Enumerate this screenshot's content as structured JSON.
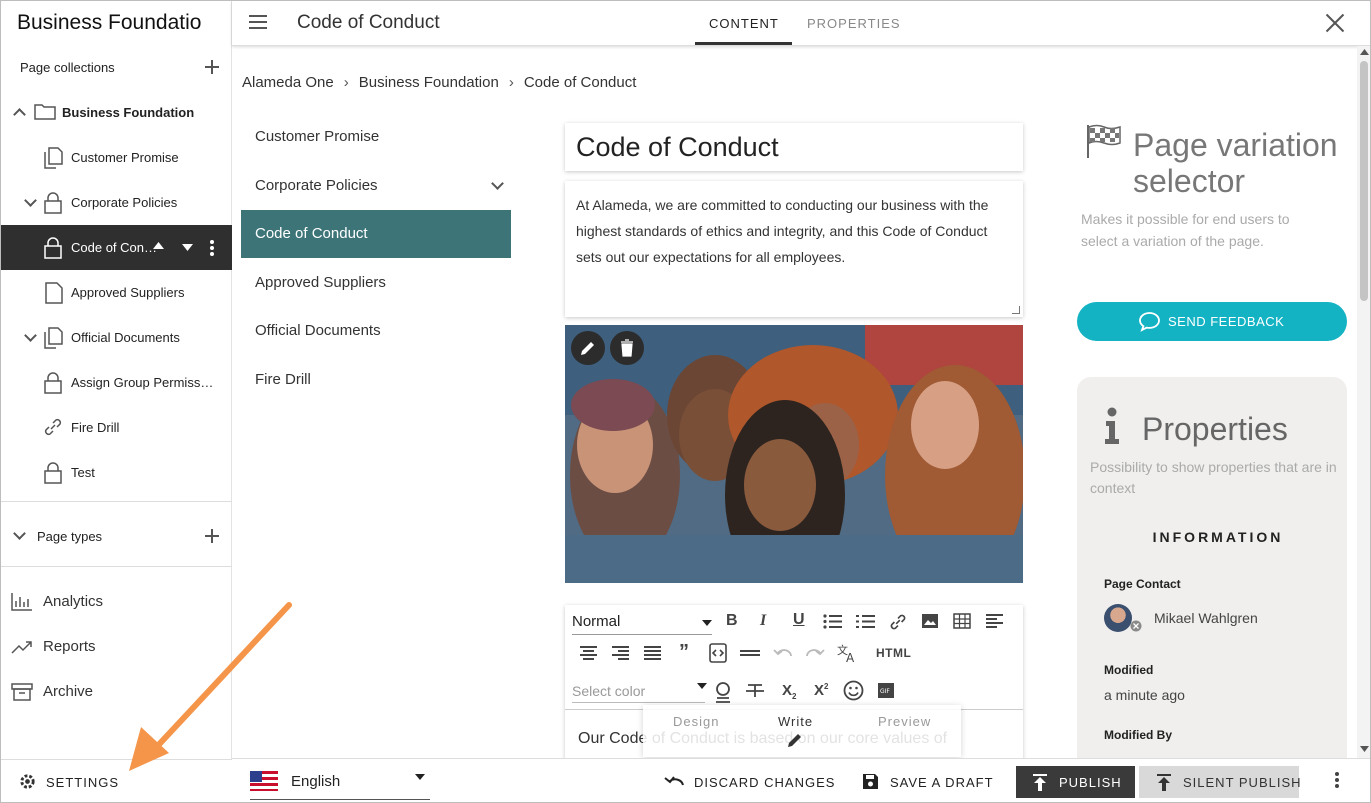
{
  "sidebar": {
    "title": "Business Foundatio",
    "collections_label": "Page collections",
    "tree": [
      {
        "label": "Business Foundation"
      },
      {
        "label": "Customer Promise"
      },
      {
        "label": "Corporate Policies"
      },
      {
        "label": "Code of Con…"
      },
      {
        "label": "Approved Suppliers"
      },
      {
        "label": "Official Documents"
      },
      {
        "label": "Assign Group Permiss…"
      },
      {
        "label": "Fire Drill"
      },
      {
        "label": "Test"
      }
    ],
    "page_types_label": "Page types",
    "nav": [
      {
        "label": "Analytics",
        "icon": "analytics-icon"
      },
      {
        "label": "Reports",
        "icon": "trending-up-icon"
      },
      {
        "label": "Archive",
        "icon": "archive-icon"
      }
    ],
    "settings_label": "SETTINGS"
  },
  "topbar": {
    "title": "Code of Conduct",
    "tabs": [
      {
        "label": "CONTENT",
        "active": true
      },
      {
        "label": "PROPERTIES",
        "active": false
      }
    ]
  },
  "breadcrumb": [
    "Alameda One",
    "Business Foundation",
    "Code of Conduct"
  ],
  "subnav": [
    {
      "label": "Customer Promise"
    },
    {
      "label": "Corporate Policies"
    },
    {
      "label": "Code of Conduct"
    },
    {
      "label": "Approved Suppliers"
    },
    {
      "label": "Official Documents"
    },
    {
      "label": "Fire Drill"
    }
  ],
  "content": {
    "title": "Code of Conduct",
    "intro": "At Alameda, we are committed to conducting our business with the highest standards of ethics and integrity, and this Code of Conduct sets out our expectations for all employees.",
    "editor": {
      "format": "Normal",
      "color_placeholder": "Select color",
      "html_label": "HTML",
      "body": "Our Code of Conduct is based on our core values of",
      "modes": [
        "Design",
        "Write",
        "Preview"
      ]
    }
  },
  "right": {
    "pv_title_1": "Page variation",
    "pv_title_2": "selector",
    "pv_desc": "Makes it possible for end users to select a variation of the page.",
    "feedback_label": "SEND FEEDBACK",
    "props_title": "Properties",
    "props_desc": "Possibility to show properties that are in context",
    "info_heading": "INFORMATION",
    "contact_label": "Page Contact",
    "contact_name": "Mikael Wahlgren",
    "modified_label": "Modified",
    "modified_value": "a minute ago",
    "modified_by_label": "Modified By"
  },
  "bottombar": {
    "language": "English",
    "discard": "DISCARD CHANGES",
    "save_draft": "SAVE A DRAFT",
    "publish": "PUBLISH",
    "silent_publish": "SILENT PUBLISH"
  },
  "colors": {
    "active_subnav": "#3d7478",
    "feedback": "#14b3c4",
    "arrow": "#f4954a",
    "sidebar_active": "#2f2f2f"
  }
}
